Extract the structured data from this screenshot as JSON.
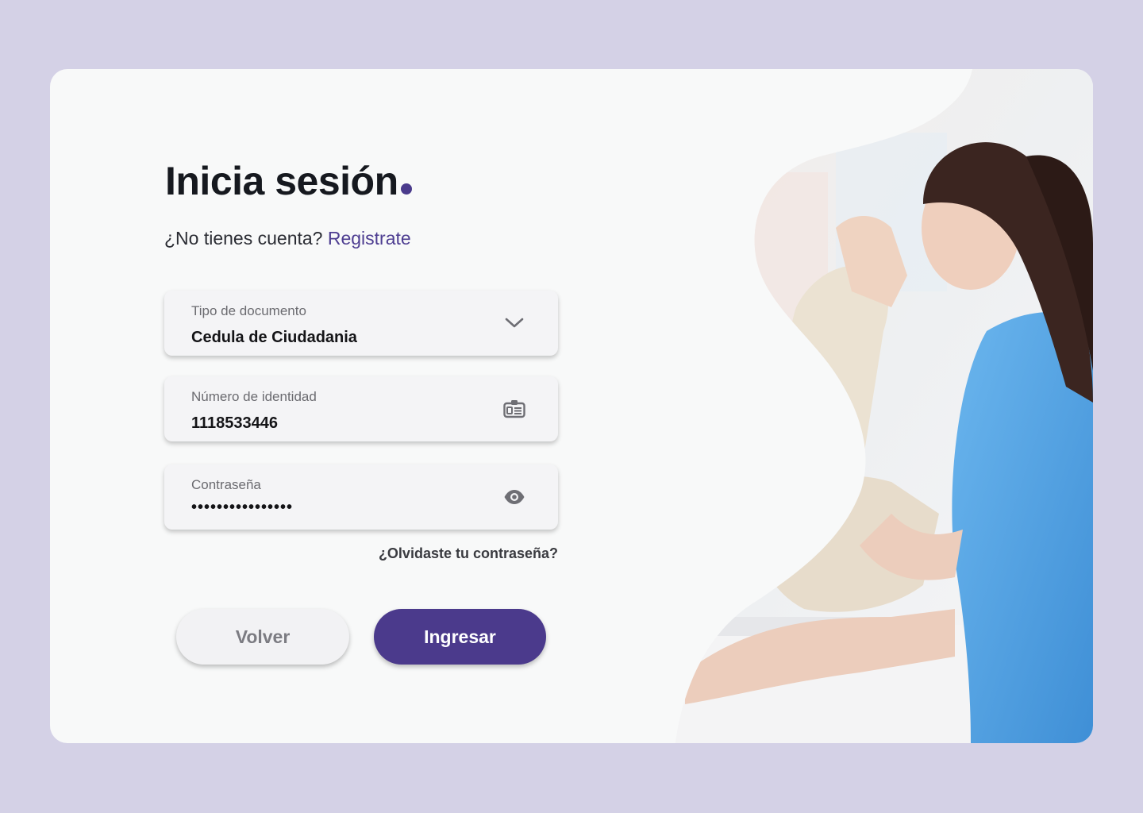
{
  "login": {
    "title": "Inicia sesión",
    "no_account_text": "¿No tienes cuenta?",
    "register_link": "Registrate",
    "document_type": {
      "label": "Tipo de documento",
      "value": "Cedula de Ciudadania",
      "icon": "chevron-down-icon"
    },
    "id_number": {
      "label": "Número de identidad",
      "value": "1118533446",
      "icon": "id-card-icon"
    },
    "password": {
      "label": "Contraseña",
      "value": "••••••••••••••••",
      "icon": "eye-icon"
    },
    "forgot_password": "¿Olvidaste tu contraseña?",
    "back_button": "Volver",
    "login_button": "Ingresar"
  },
  "colors": {
    "background": "#d4d1e6",
    "card": "#f8f9f9",
    "accent": "#4b3a8c",
    "scrubs": "#5aa7e6"
  }
}
